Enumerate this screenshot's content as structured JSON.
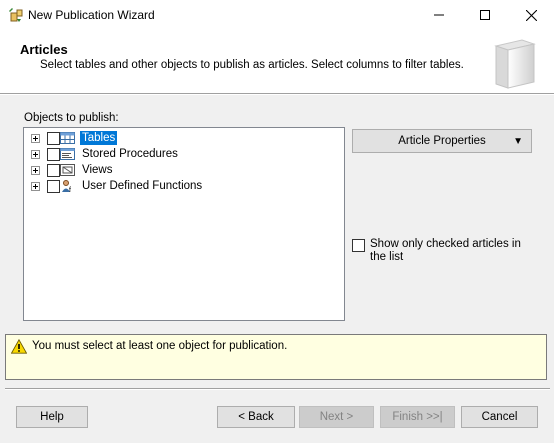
{
  "window": {
    "title": "New Publication Wizard",
    "controls": [
      "minimize",
      "maximize",
      "close"
    ]
  },
  "header": {
    "title": "Articles",
    "subtitle": "Select tables and other objects to publish as articles. Select columns to filter tables."
  },
  "objects_label": "Objects to publish:",
  "tree": [
    {
      "label": "Tables",
      "icon": "table-icon",
      "selected": true,
      "checked": false
    },
    {
      "label": "Stored Procedures",
      "icon": "stored-procedure-icon",
      "selected": false,
      "checked": false
    },
    {
      "label": "Views",
      "icon": "view-icon",
      "selected": false,
      "checked": false
    },
    {
      "label": "User Defined Functions",
      "icon": "function-icon",
      "selected": false,
      "checked": false
    }
  ],
  "article_properties_button": "Article Properties",
  "show_checked": {
    "label": "Show only checked articles in the list",
    "checked": false
  },
  "warning": {
    "icon": "warning-icon",
    "text": "You must select at least one object for publication."
  },
  "buttons": {
    "help": "Help",
    "back": "< Back",
    "next": "Next >",
    "finish": "Finish >>|",
    "cancel": "Cancel"
  },
  "colors": {
    "selection": "#0078d7",
    "warning_bg": "#ffffe1",
    "dialog_bg": "#f0f0f0"
  }
}
